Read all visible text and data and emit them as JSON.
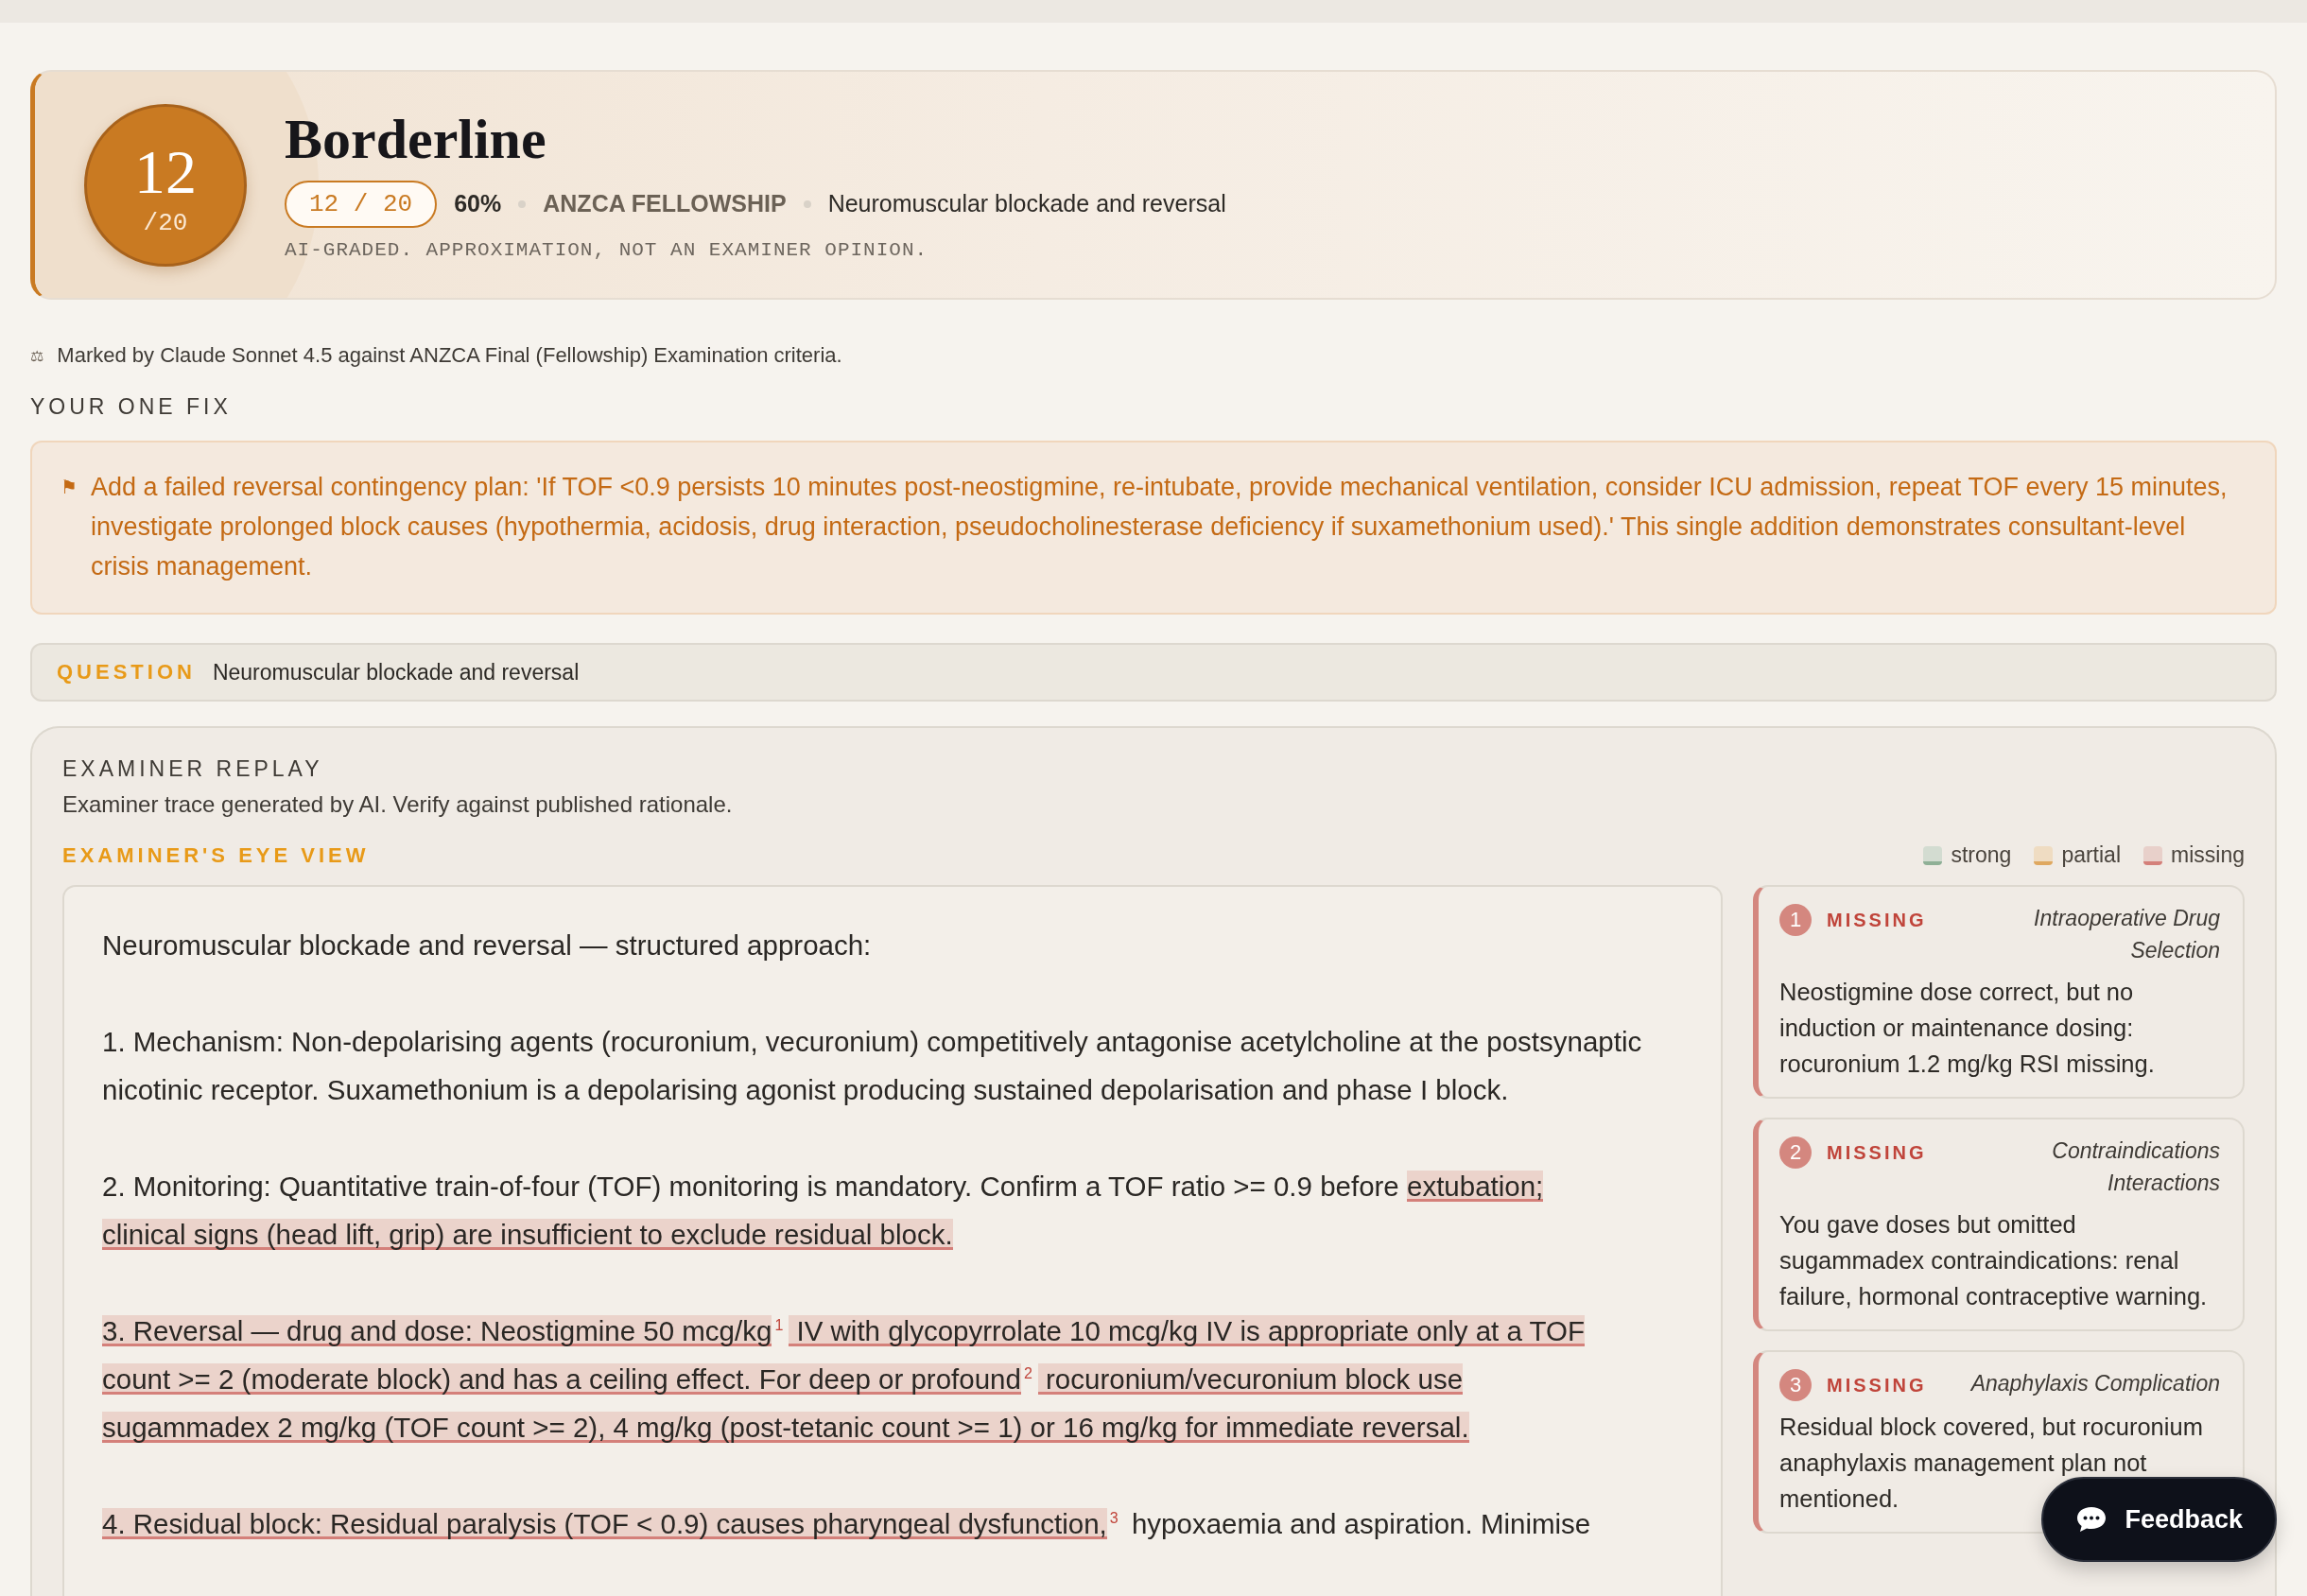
{
  "score": {
    "value": "12",
    "out_of": "/20",
    "verdict": "Borderline",
    "pill": "12 / 20",
    "percent": "60%",
    "exam": "ANZCA FELLOWSHIP",
    "topic": "Neuromuscular blockade and reversal",
    "disclaimer": "AI-GRADED. APPROXIMATION, NOT AN EXAMINER OPINION."
  },
  "marked_by": {
    "icon": "⚖",
    "text": "Marked by Claude Sonnet 4.5 against ANZCA Final (Fellowship) Examination criteria."
  },
  "one_fix": {
    "heading": "YOUR ONE FIX",
    "icon": "⚑",
    "text": "Add a failed reversal contingency plan: 'If TOF <0.9 persists 10 minutes post-neostigmine, re-intubate, provide mechanical ventilation, consider ICU admission, repeat TOF every 15 minutes, investigate prolonged block causes (hypothermia, acidosis, drug interaction, pseudocholinesterase deficiency if suxamethonium used).' This single addition demonstrates consultant-level crisis management."
  },
  "question": {
    "label": "QUESTION",
    "text": "Neuromuscular blockade and reversal"
  },
  "replay": {
    "heading": "EXAMINER REPLAY",
    "subtitle": "Examiner trace generated by AI. Verify against published rationale.",
    "view_heading": "EXAMINER'S EYE VIEW",
    "legend": [
      {
        "label": "strong",
        "color": "#d3dcd1"
      },
      {
        "label": "partial",
        "color": "#efdcc2"
      },
      {
        "label": "missing",
        "color": "#e8d0ca"
      }
    ],
    "answer": [
      {
        "kind": "plain",
        "text": "Neuromuscular blockade and reversal — structured approach:"
      },
      {
        "kind": "plain",
        "text": "1. Mechanism: Non-depolarising agents (rocuronium, vecuronium) competitively antagonise acetylcholine at the postsynaptic nicotinic receptor. Suxamethonium is a depolarising agonist producing sustained depolarisation and phase I block."
      },
      {
        "kind": "marked",
        "lines": [
          [
            {
              "text": "2. Monitoring: Quantitative train-of-four (TOF) monitoring is mandatory. Confirm a TOF ratio >= 0.9 before ",
              "missing": false
            },
            {
              "text": "extubation;",
              "missing": true
            }
          ],
          [
            {
              "text": "clinical signs (head lift, grip) are insufficient to exclude residual block.",
              "missing": true
            }
          ]
        ]
      },
      {
        "kind": "marked",
        "lines": [
          [
            {
              "text": "3. Reversal — drug and dose: Neostigmine 50 mcg/kg",
              "missing": true,
              "note": "1"
            },
            {
              "text": " IV with glycopyrrolate 10 mcg/kg IV is appropriate only at a TOF",
              "missing": true
            }
          ],
          [
            {
              "text": "count >= 2 (moderate block) and has a ceiling effect. For deep or profound",
              "missing": true,
              "note": "2"
            },
            {
              "text": " rocuronium/vecuronium block use",
              "missing": true
            }
          ],
          [
            {
              "text": "sugammadex 2 mg/kg (TOF count >= 2), 4 mg/kg (post-tetanic count >= 1) or 16 mg/kg for immediate reversal.",
              "missing": true
            }
          ]
        ]
      },
      {
        "kind": "marked",
        "lines": [
          [
            {
              "text": "4. Residual block: Residual paralysis (TOF < 0.9) causes pharyngeal dysfunction,",
              "missing": true,
              "note": "3"
            },
            {
              "text": " hypoxaemia and aspiration. Minimise",
              "missing": false
            }
          ]
        ]
      }
    ],
    "findings": [
      {
        "number": "1",
        "status": "MISSING",
        "category": "Intraoperative Drug Selection",
        "text": "Neostigmine dose correct, but no induction or maintenance dosing: rocuronium 1.2 mg/kg RSI missing."
      },
      {
        "number": "2",
        "status": "MISSING",
        "category": "Contraindications Interactions",
        "text": "You gave doses but omitted sugammadex contraindications: renal failure, hormonal contraceptive warning."
      },
      {
        "number": "3",
        "status": "MISSING",
        "category": "Anaphylaxis Complication",
        "text": "Residual block covered, but rocuronium anaphylaxis management plan not mentioned."
      }
    ]
  },
  "feedback_button": {
    "label": "Feedback"
  }
}
